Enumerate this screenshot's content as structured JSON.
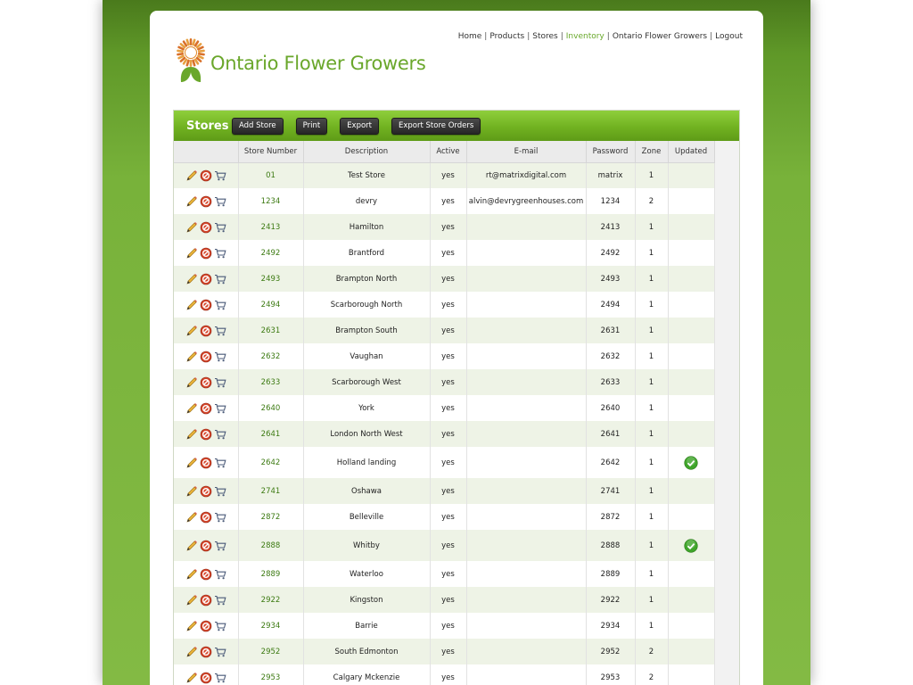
{
  "brand": {
    "name": "Ontario Flower Growers"
  },
  "nav": {
    "items": [
      {
        "label": "Home",
        "active": false
      },
      {
        "label": "Products",
        "active": false
      },
      {
        "label": "Stores",
        "active": false
      },
      {
        "label": "Inventory",
        "active": true
      },
      {
        "label": "Ontario Flower Growers",
        "active": false
      },
      {
        "label": "Logout",
        "active": false
      }
    ]
  },
  "panel": {
    "title": "Stores",
    "buttons": {
      "add_store": "Add Store",
      "print": "Print",
      "export": "Export",
      "export_orders": "Export Store Orders"
    }
  },
  "table": {
    "headers": {
      "actions": "",
      "store_number": "Store Number",
      "description": "Description",
      "active": "Active",
      "email": "E-mail",
      "password": "Password",
      "zone": "Zone",
      "updated": "Updated"
    },
    "rows": [
      {
        "store_number": "01",
        "description": "Test Store",
        "active": "yes",
        "email": "rt@matrixdigital.com",
        "password": "matrix",
        "zone": "1",
        "updated": false
      },
      {
        "store_number": "1234",
        "description": "devry",
        "active": "yes",
        "email": "alvin@devrygreenhouses.com",
        "password": "1234",
        "zone": "2",
        "updated": false
      },
      {
        "store_number": "2413",
        "description": "Hamilton",
        "active": "yes",
        "email": "",
        "password": "2413",
        "zone": "1",
        "updated": false
      },
      {
        "store_number": "2492",
        "description": "Brantford",
        "active": "yes",
        "email": "",
        "password": "2492",
        "zone": "1",
        "updated": false
      },
      {
        "store_number": "2493",
        "description": "Brampton North",
        "active": "yes",
        "email": "",
        "password": "2493",
        "zone": "1",
        "updated": false
      },
      {
        "store_number": "2494",
        "description": "Scarborough North",
        "active": "yes",
        "email": "",
        "password": "2494",
        "zone": "1",
        "updated": false
      },
      {
        "store_number": "2631",
        "description": "Brampton South",
        "active": "yes",
        "email": "",
        "password": "2631",
        "zone": "1",
        "updated": false
      },
      {
        "store_number": "2632",
        "description": "Vaughan",
        "active": "yes",
        "email": "",
        "password": "2632",
        "zone": "1",
        "updated": false
      },
      {
        "store_number": "2633",
        "description": "Scarborough West",
        "active": "yes",
        "email": "",
        "password": "2633",
        "zone": "1",
        "updated": false
      },
      {
        "store_number": "2640",
        "description": "York",
        "active": "yes",
        "email": "",
        "password": "2640",
        "zone": "1",
        "updated": false
      },
      {
        "store_number": "2641",
        "description": "London North West",
        "active": "yes",
        "email": "",
        "password": "2641",
        "zone": "1",
        "updated": false
      },
      {
        "store_number": "2642",
        "description": "Holland landing",
        "active": "yes",
        "email": "",
        "password": "2642",
        "zone": "1",
        "updated": true
      },
      {
        "store_number": "2741",
        "description": "Oshawa",
        "active": "yes",
        "email": "",
        "password": "2741",
        "zone": "1",
        "updated": false
      },
      {
        "store_number": "2872",
        "description": "Belleville",
        "active": "yes",
        "email": "",
        "password": "2872",
        "zone": "1",
        "updated": false
      },
      {
        "store_number": "2888",
        "description": "Whitby",
        "active": "yes",
        "email": "",
        "password": "2888",
        "zone": "1",
        "updated": true
      },
      {
        "store_number": "2889",
        "description": "Waterloo",
        "active": "yes",
        "email": "",
        "password": "2889",
        "zone": "1",
        "updated": false
      },
      {
        "store_number": "2922",
        "description": "Kingston",
        "active": "yes",
        "email": "",
        "password": "2922",
        "zone": "1",
        "updated": false
      },
      {
        "store_number": "2934",
        "description": "Barrie",
        "active": "yes",
        "email": "",
        "password": "2934",
        "zone": "1",
        "updated": false
      },
      {
        "store_number": "2952",
        "description": "South Edmonton",
        "active": "yes",
        "email": "",
        "password": "2952",
        "zone": "2",
        "updated": false
      },
      {
        "store_number": "2953",
        "description": "Calgary Mckenzie",
        "active": "yes",
        "email": "",
        "password": "2953",
        "zone": "2",
        "updated": false
      }
    ]
  },
  "colors": {
    "brand_green": "#6aa72b",
    "header_green": "#71b221",
    "row_alt": "#eef3e6",
    "check_green": "#3fa52a"
  },
  "icons": [
    "edit-pencil-icon",
    "delete-icon",
    "cart-icon",
    "check-icon"
  ]
}
